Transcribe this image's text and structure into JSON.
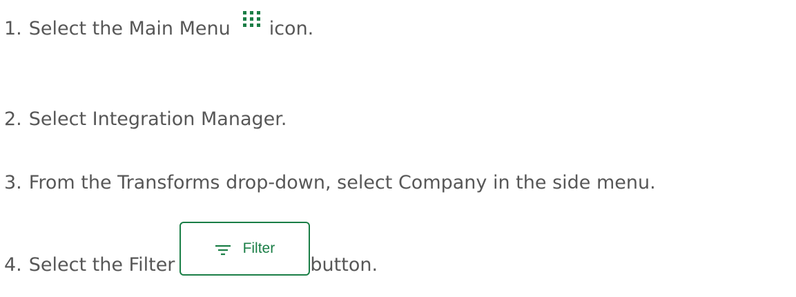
{
  "steps": [
    {
      "number": "1.",
      "before": "Select the Main Menu",
      "after": "icon.",
      "icon": "main-menu-grid-icon"
    },
    {
      "number": "2.",
      "text": "Select Integration Manager."
    },
    {
      "number": "3.",
      "text": "From the Transforms drop-down, select Company in the side menu."
    },
    {
      "number": "4.",
      "before": "Select the Filter",
      "after": "button.",
      "button_label": "Filter",
      "button_icon": "filter-lines-icon"
    }
  ],
  "colors": {
    "text": "#575757",
    "accent_green": "#1a7e46"
  }
}
